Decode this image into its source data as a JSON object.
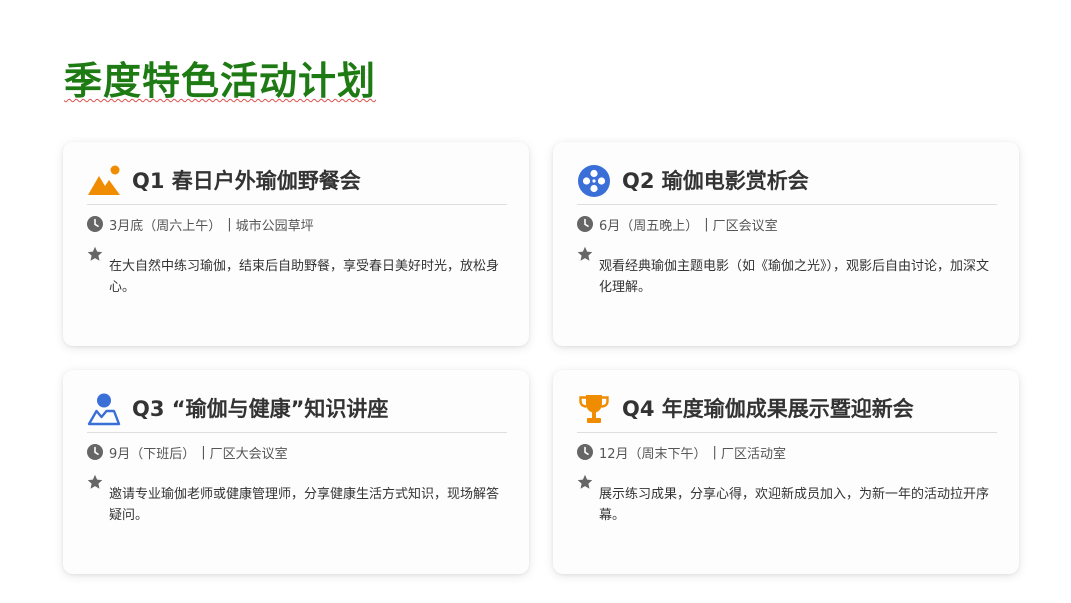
{
  "page": {
    "title": "季度特色活动计划"
  },
  "colors": {
    "title_green": "#1e7a12",
    "orange": "#f08c00",
    "blue": "#3a6fd8",
    "icon_gray": "#666666"
  },
  "cards": [
    {
      "icon": "mountain-sun-icon",
      "title": "Q1 春日户外瑜伽野餐会",
      "time": "3月底（周六上午）",
      "separator": "|",
      "location": "城市公园草坪",
      "description": "在大自然中练习瑜伽，结束后自助野餐，享受春日美好时光，放松身心。"
    },
    {
      "icon": "film-reel-icon",
      "title": "Q2 瑜伽电影赏析会",
      "time": "6月（周五晚上）",
      "separator": "|",
      "location": "厂区会议室",
      "description": "观看经典瑜伽主题电影（如《瑜伽之光》），观影后自由讨论，加深文化理解。"
    },
    {
      "icon": "person-icon",
      "title": "Q3 “瑜伽与健康”知识讲座",
      "time": "9月（下班后）",
      "separator": "|",
      "location": "厂区大会议室",
      "description": "邀请专业瑜伽老师或健康管理师，分享健康生活方式知识，现场解答疑问。"
    },
    {
      "icon": "trophy-icon",
      "title": "Q4 年度瑜伽成果展示暨迎新会",
      "time": "12月（周末下午）",
      "separator": "|",
      "location": "厂区活动室",
      "description": "展示练习成果，分享心得，欢迎新成员加入，为新一年的活动拉开序幕。"
    }
  ]
}
